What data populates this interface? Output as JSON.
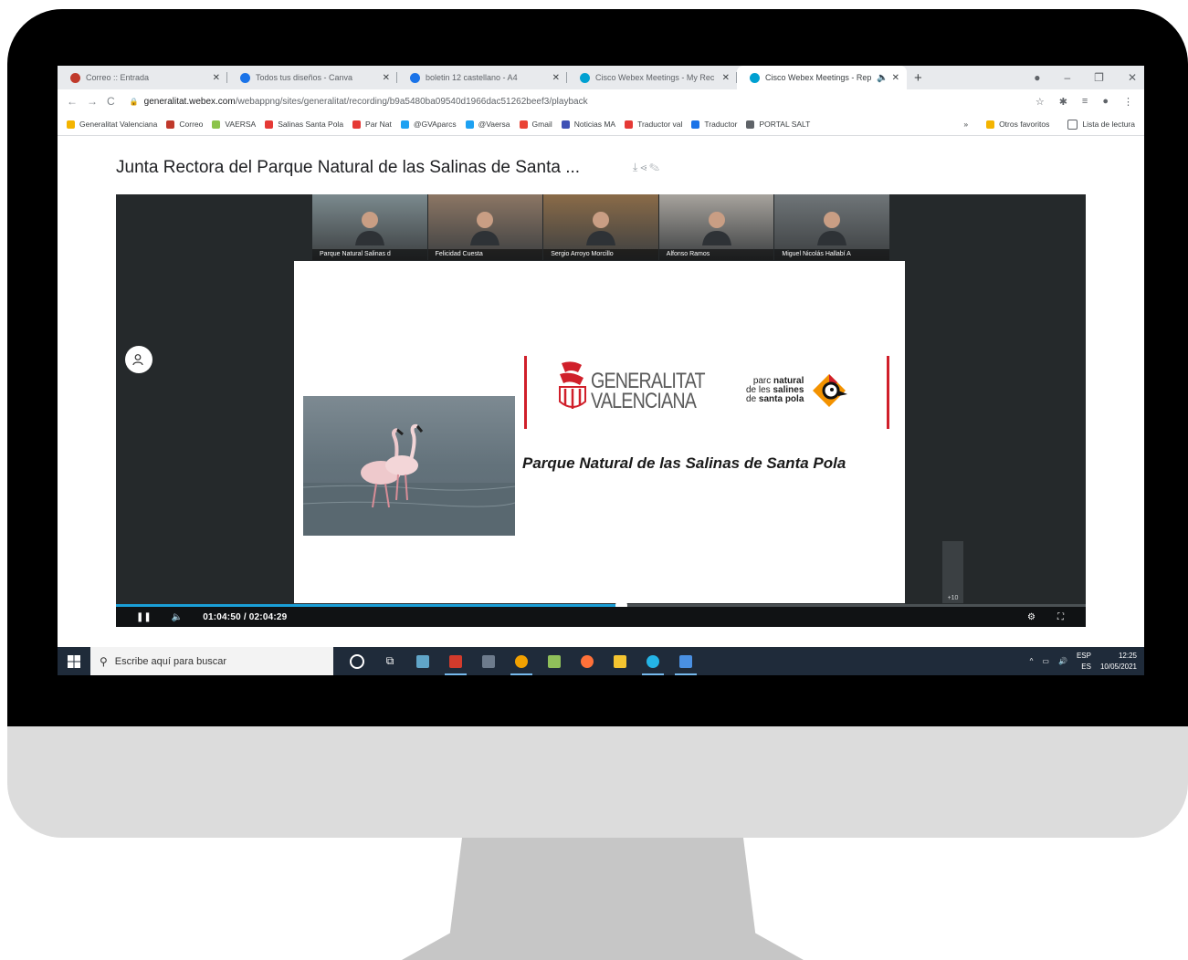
{
  "browser": {
    "tabs": [
      {
        "title": "Correo :: Entrada",
        "favicon": "mail-icon",
        "color": "#c0392b",
        "active": false
      },
      {
        "title": "Todos tus diseños - Canva",
        "favicon": "canva-icon",
        "color": "#1a73e8",
        "active": false
      },
      {
        "title": "boletin 12 castellano - A4",
        "favicon": "canva-icon",
        "color": "#1a73e8",
        "active": false
      },
      {
        "title": "Cisco Webex Meetings - My Rec",
        "favicon": "webex-icon",
        "color": "#00a0d1",
        "active": false
      },
      {
        "title": "Cisco Webex Meetings - Rep",
        "favicon": "webex-icon",
        "color": "#00a0d1",
        "active": true
      }
    ],
    "new_tab": "+",
    "url_host": "generalitat.webex.com",
    "url_path": "/webappng/sites/generalitat/recording/b9a5480ba09540d1966dac51262beef3/playback",
    "bookmarks": [
      {
        "label": "Generalitat Valenciana",
        "color": "#f4b400"
      },
      {
        "label": "Correo",
        "color": "#c0392b"
      },
      {
        "label": "VAERSA",
        "color": "#8bc34a"
      },
      {
        "label": "Salinas Santa Pola",
        "color": "#e53935"
      },
      {
        "label": "Par Nat",
        "color": "#e53935"
      },
      {
        "label": "@GVAparcs",
        "color": "#1da1f2"
      },
      {
        "label": "@Vaersa",
        "color": "#1da1f2"
      },
      {
        "label": "Gmail",
        "color": "#ea4335"
      },
      {
        "label": "Noticias MA",
        "color": "#3f51b5"
      },
      {
        "label": "Traductor val",
        "color": "#e53935"
      },
      {
        "label": "Traductor",
        "color": "#1a73e8"
      },
      {
        "label": "PORTAL SALT",
        "color": "#5f6368"
      }
    ],
    "bookmarks_more": "»",
    "other_favorites": "Otros favoritos",
    "reading_list": "Lista de lectura"
  },
  "recording": {
    "title": "Junta Rectora del Parque Natural de las Salinas de Santa ...",
    "participants": [
      {
        "name": "Parque Natural Salinas d",
        "bg": "#7b8a8e"
      },
      {
        "name": "Felicidad Cuesta",
        "bg": "#8c7664"
      },
      {
        "name": "Sergio Arroyo Morcillo",
        "bg": "#8a6b48"
      },
      {
        "name": "Alfonso Ramos",
        "bg": "#a7a39d"
      },
      {
        "name": "Miguel Nicolás Hallabí A",
        "bg": "#6f7578"
      }
    ],
    "slide": {
      "gv_line1": "GENERALITAT",
      "gv_line2": "VALENCIANA",
      "pn_line1_a": "parc",
      "pn_line1_b": "natural",
      "pn_line2_a": "de les",
      "pn_line2_b": "salines",
      "pn_line3_a": "de",
      "pn_line3_b": "santa pola",
      "title": "Parque Natural de las Salinas de Santa Pola"
    },
    "more_participants": "+10",
    "time": "01:04:50 / 02:04:29",
    "progress": 0.521,
    "accent_color": "#1a9fd8"
  },
  "taskbar": {
    "search_placeholder": "Escribe aquí para buscar",
    "apps": [
      {
        "name": "cortana-icon",
        "color": "#ffffff",
        "open": false
      },
      {
        "name": "task-view-icon",
        "color": "#ffffff",
        "open": false
      },
      {
        "name": "paint-icon",
        "color": "#60a5c8",
        "open": false
      },
      {
        "name": "pdf-icon",
        "color": "#d33b2c",
        "open": true
      },
      {
        "name": "calculator-icon",
        "color": "#6d7b8c",
        "open": false
      },
      {
        "name": "chrome-icon",
        "color": "#f2a100",
        "open": true
      },
      {
        "name": "photos-icon",
        "color": "#8fbf5a",
        "open": false
      },
      {
        "name": "firefox-icon",
        "color": "#ff7139",
        "open": false
      },
      {
        "name": "file-explorer-icon",
        "color": "#f4c430",
        "open": false
      },
      {
        "name": "webex-icon",
        "color": "#24b4e6",
        "open": true
      },
      {
        "name": "document-icon",
        "color": "#4a90e2",
        "open": true
      }
    ],
    "lang_top": "ESP",
    "lang_bottom": "ES",
    "clock_time": "12:25",
    "clock_date": "10/05/2021"
  }
}
